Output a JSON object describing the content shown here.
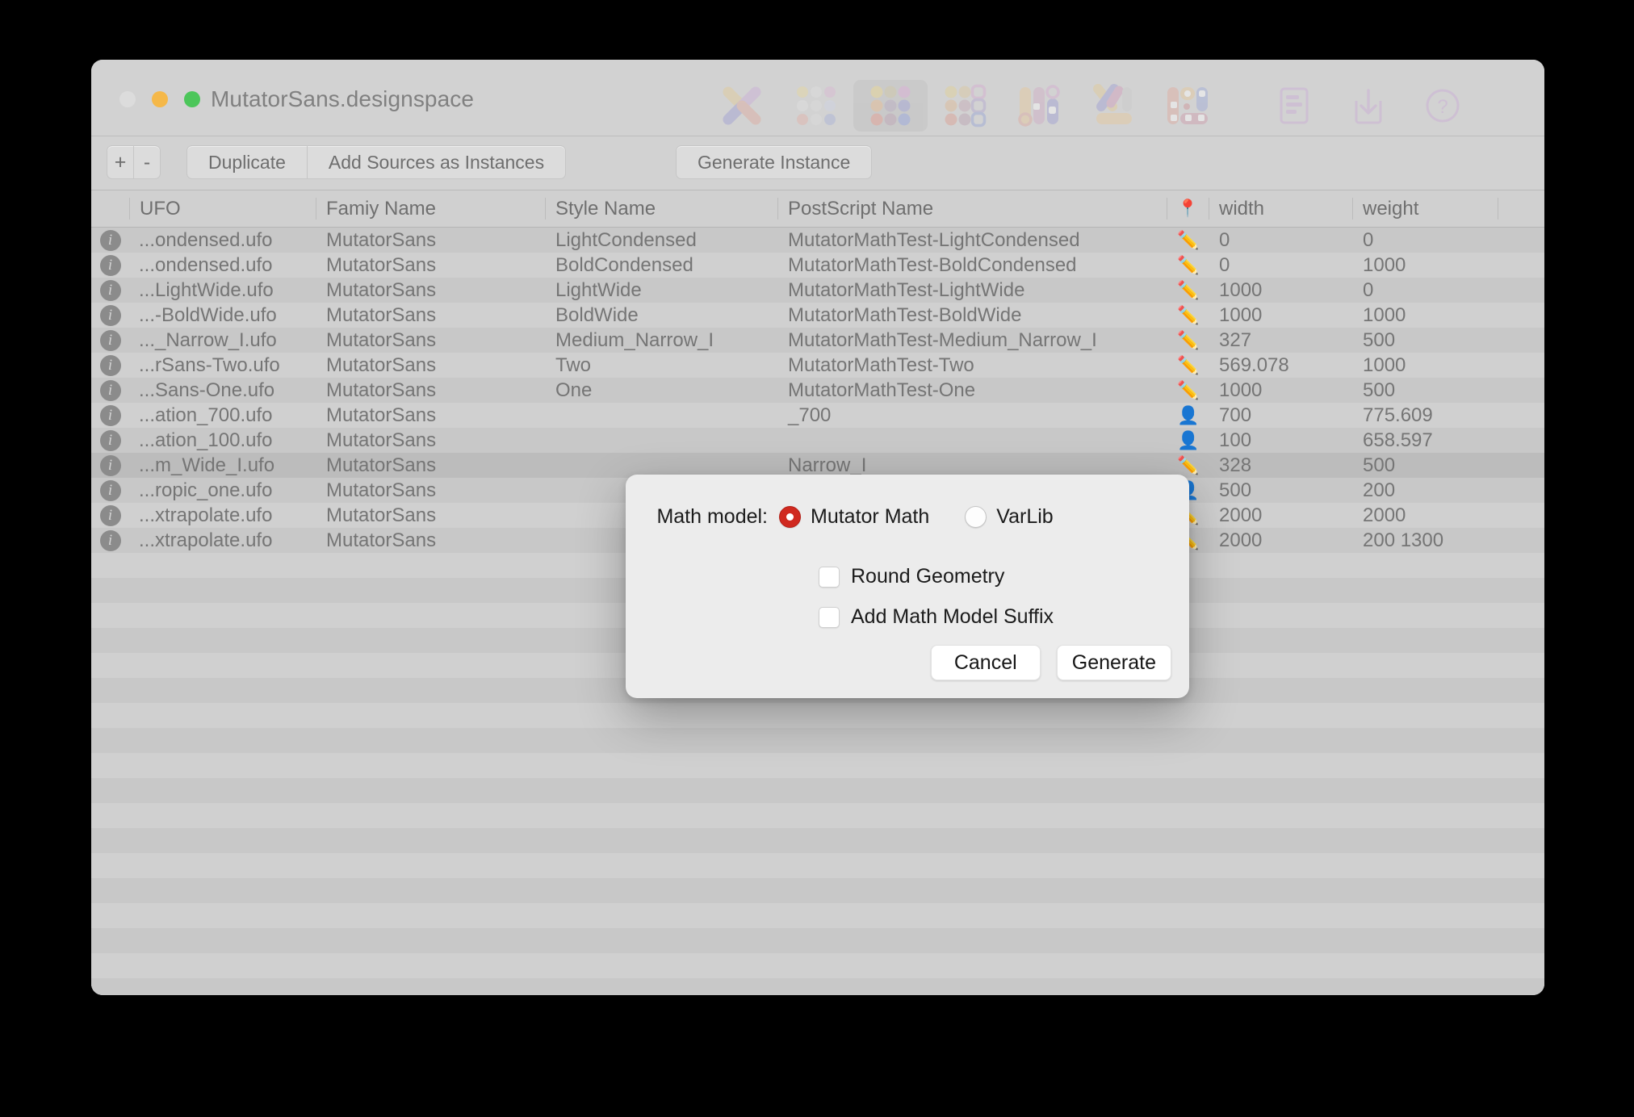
{
  "window": {
    "title": "MutatorSans.designspace",
    "traffic_lights": [
      "close-button",
      "minimize-button",
      "maximize-button"
    ]
  },
  "toolbar": {
    "items": [
      {
        "name": "designspace-axes-icon",
        "selected": false
      },
      {
        "name": "sources-grid-sparse-icon",
        "selected": false
      },
      {
        "name": "sources-grid-icon",
        "selected": true
      },
      {
        "name": "instances-grid-icon",
        "selected": false
      },
      {
        "name": "axes-bars-icon",
        "selected": false
      },
      {
        "name": "rules-icon",
        "selected": false
      },
      {
        "name": "variable-fonts-icon",
        "selected": false
      }
    ],
    "right_items": [
      {
        "name": "notes-document-icon"
      },
      {
        "name": "download-icon"
      },
      {
        "name": "help-icon"
      }
    ]
  },
  "actionbar": {
    "add_label": "+",
    "remove_label": "-",
    "duplicate_label": "Duplicate",
    "add_sources_label": "Add Sources as Instances",
    "generate_instance_label": "Generate Instance"
  },
  "table": {
    "columns": [
      "UFO",
      "Famiy Name",
      "Style Name",
      "PostScript Name",
      "📍",
      "width",
      "weight"
    ],
    "rows": [
      {
        "ufo": "...ondensed.ufo",
        "family": "MutatorSans",
        "style": "LightCondensed",
        "psname": "MutatorMathTest-LightCondensed",
        "kind": "✏️",
        "width": "0",
        "weight": "0",
        "selected": false
      },
      {
        "ufo": "...ondensed.ufo",
        "family": "MutatorSans",
        "style": "BoldCondensed",
        "psname": "MutatorMathTest-BoldCondensed",
        "kind": "✏️",
        "width": "0",
        "weight": "1000",
        "selected": false
      },
      {
        "ufo": "...LightWide.ufo",
        "family": "MutatorSans",
        "style": "LightWide",
        "psname": "MutatorMathTest-LightWide",
        "kind": "✏️",
        "width": "1000",
        "weight": "0",
        "selected": false
      },
      {
        "ufo": "...-BoldWide.ufo",
        "family": "MutatorSans",
        "style": "BoldWide",
        "psname": "MutatorMathTest-BoldWide",
        "kind": "✏️",
        "width": "1000",
        "weight": "1000",
        "selected": false
      },
      {
        "ufo": "..._Narrow_I.ufo",
        "family": "MutatorSans",
        "style": "Medium_Narrow_I",
        "psname": "MutatorMathTest-Medium_Narrow_I",
        "kind": "✏️",
        "width": "327",
        "weight": "500",
        "selected": false
      },
      {
        "ufo": "...rSans-Two.ufo",
        "family": "MutatorSans",
        "style": "Two",
        "psname": "MutatorMathTest-Two",
        "kind": "✏️",
        "width": "569.078",
        "weight": "1000",
        "selected": false
      },
      {
        "ufo": "...Sans-One.ufo",
        "family": "MutatorSans",
        "style": "One",
        "psname": "MutatorMathTest-One",
        "kind": "✏️",
        "width": "1000",
        "weight": "500",
        "selected": false
      },
      {
        "ufo": "...ation_700.ufo",
        "family": "MutatorSans",
        "style": "",
        "psname": "_700",
        "kind": "👤",
        "width": "700",
        "weight": "775.609",
        "selected": false
      },
      {
        "ufo": "...ation_100.ufo",
        "family": "MutatorSans",
        "style": "",
        "psname": "",
        "kind": "👤",
        "width": "100",
        "weight": "658.597",
        "selected": false
      },
      {
        "ufo": "...m_Wide_I.ufo",
        "family": "MutatorSans",
        "style": "",
        "psname": "Narrow_I",
        "kind": "✏️",
        "width": "328",
        "weight": "500",
        "selected": true
      },
      {
        "ufo": "...ropic_one.ufo",
        "family": "MutatorSans",
        "style": "",
        "psname": "",
        "kind": "👤",
        "width": "500",
        "weight": "200",
        "selected": false
      },
      {
        "ufo": "...xtrapolate.ufo",
        "family": "MutatorSans",
        "style": "",
        "psname": "",
        "kind": "✏️",
        "width": "2000",
        "weight": "2000",
        "selected": false
      },
      {
        "ufo": "...xtrapolate.ufo",
        "family": "MutatorSans",
        "style": "",
        "psname": "",
        "kind": "✏️",
        "width": "2000",
        "weight": "200 1300",
        "selected": false
      }
    ],
    "empty_row_count": 21,
    "info_glyph": "i"
  },
  "dialog": {
    "math_model_label": "Math model:",
    "options": [
      {
        "label": "Mutator Math",
        "selected": true
      },
      {
        "label": "VarLib",
        "selected": false
      }
    ],
    "checkboxes": [
      {
        "label": "Round Geometry",
        "checked": false
      },
      {
        "label": "Add Math Model Suffix",
        "checked": false
      }
    ],
    "cancel_label": "Cancel",
    "generate_label": "Generate"
  },
  "colors": {
    "accent_radio": "#d0291f",
    "window_chrome": "#d2d2d2",
    "table_stripe_light": "#d0d0d0",
    "table_stripe_dark": "#c8c8c8",
    "selected_row": "#bcbcbc",
    "sheet_bg": "#ececec",
    "title_text": "#808080"
  }
}
